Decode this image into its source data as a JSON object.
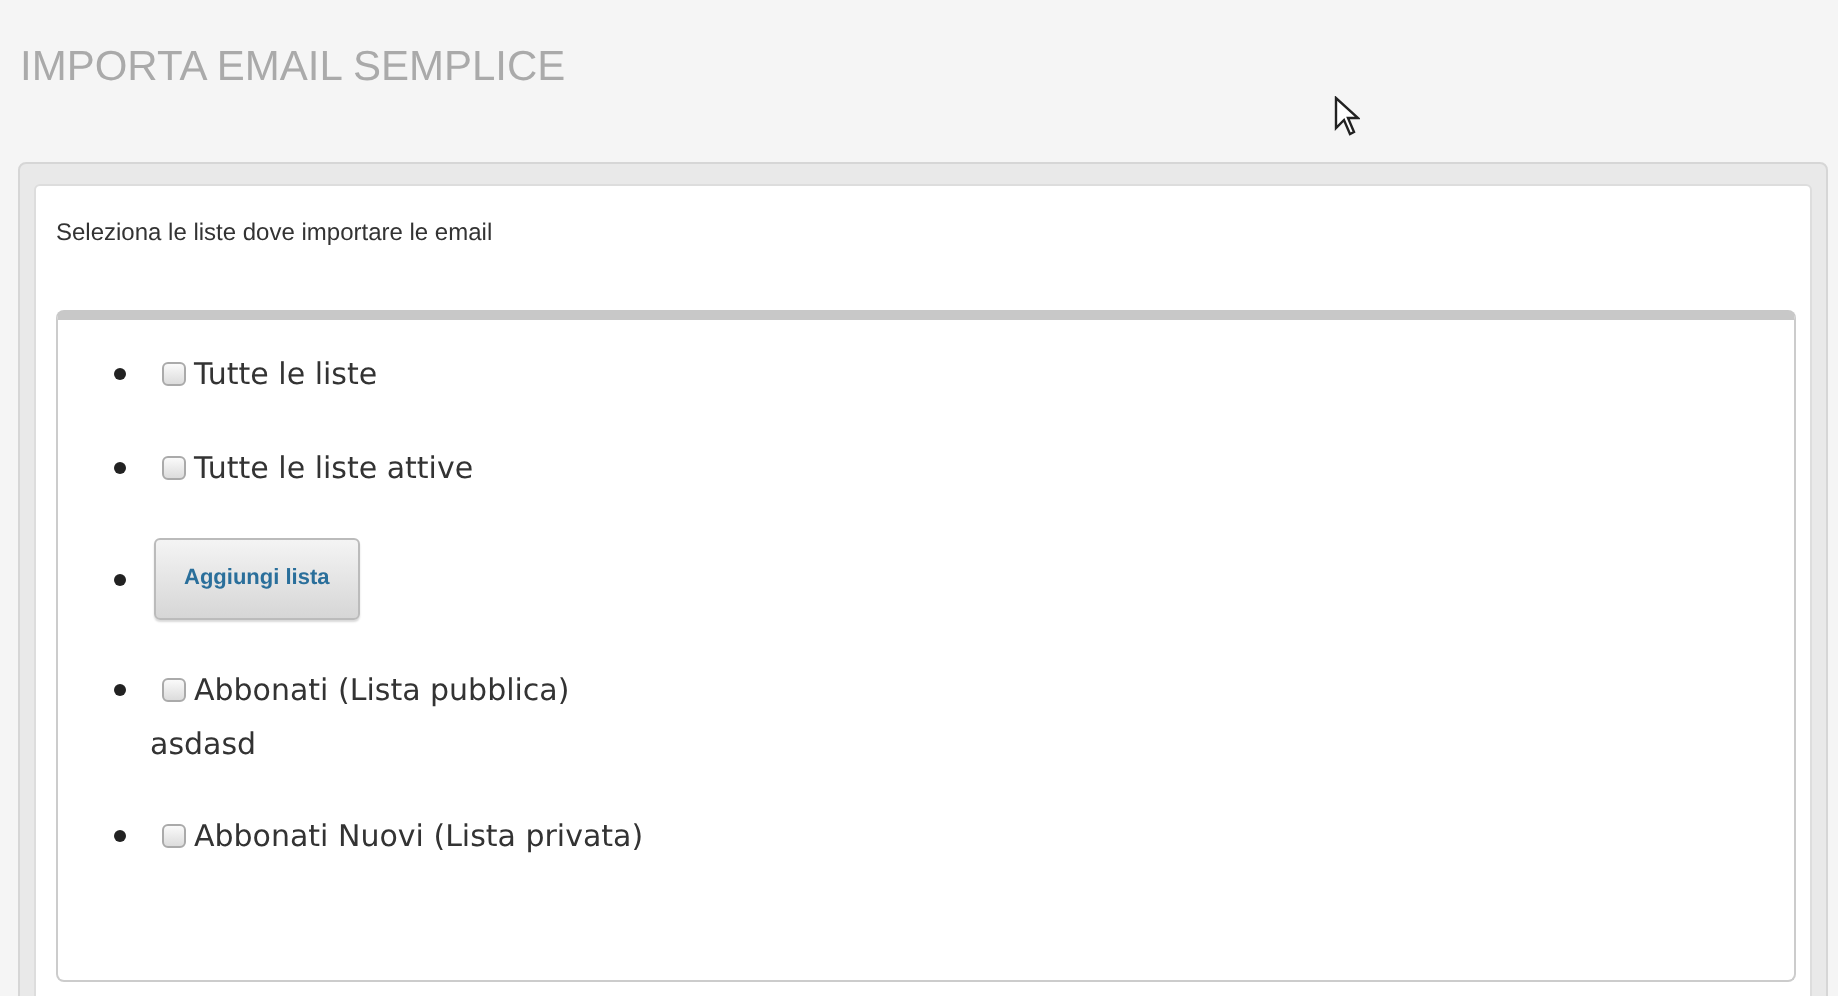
{
  "page": {
    "title": "IMPORTA EMAIL SEMPLICE"
  },
  "panel": {
    "instruction": "Seleziona le liste dove importare le email",
    "items": [
      {
        "kind": "checkbox",
        "label": "Tutte le liste",
        "checked": false
      },
      {
        "kind": "checkbox",
        "label": "Tutte le liste attive",
        "checked": false
      },
      {
        "kind": "button",
        "label": "Aggiungi lista"
      },
      {
        "kind": "checkbox",
        "label": "Abbonati (Lista pubblica)",
        "checked": false,
        "description": "asdasd"
      },
      {
        "kind": "checkbox",
        "label": "Abbonati Nuovi (Lista privata)",
        "checked": false
      }
    ]
  }
}
